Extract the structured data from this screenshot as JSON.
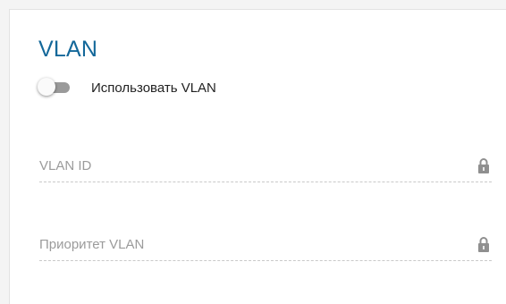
{
  "section": {
    "title": "VLAN"
  },
  "toggle": {
    "label": "Использовать VLAN",
    "checked": false
  },
  "fields": {
    "vlan_id": {
      "placeholder": "VLAN ID",
      "value": "",
      "locked": true,
      "icon": "lock-icon"
    },
    "vlan_priority": {
      "placeholder": "Приоритет VLAN",
      "value": "",
      "locked": true,
      "icon": "lock-icon"
    }
  },
  "colors": {
    "title": "#14689a",
    "toggle_track": "#9a9a9a",
    "placeholder": "#9b9b9b",
    "lock": "#8f8f8f"
  }
}
